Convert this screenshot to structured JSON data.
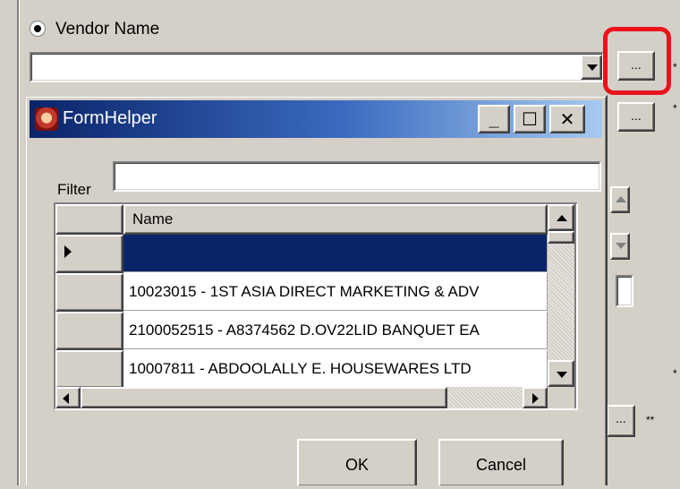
{
  "parent": {
    "radio_label": "Vendor Name",
    "vendor_value": "",
    "browse_label": "...",
    "browse2_label": "...",
    "browse3_label": "...",
    "asterisk": "*",
    "asterisk_double": "**"
  },
  "dialog": {
    "title": "FormHelper",
    "minimize_label": "_",
    "maximize_label": "☐",
    "close_label": "✕",
    "filter_label": "Filter",
    "filter_value": "",
    "grid": {
      "column_header": "Name",
      "rows": [
        {
          "name": "",
          "selected": true
        },
        {
          "name": "10023015 - 1ST ASIA DIRECT MARKETING & ADV",
          "selected": false
        },
        {
          "name": "2100052515 - A8374562 D.OV22LID BANQUET EA",
          "selected": false
        },
        {
          "name": "10007811 - ABDOOLALLY E. HOUSEWARES LTD",
          "selected": false
        }
      ]
    },
    "ok_label": "OK",
    "cancel_label": "Cancel"
  },
  "colors": {
    "highlight": "#e8141c",
    "titlebar_start": "#0a246a",
    "titlebar_end": "#a6caf0",
    "selection": "#0a246a",
    "window_bg": "#d4d0c8"
  }
}
